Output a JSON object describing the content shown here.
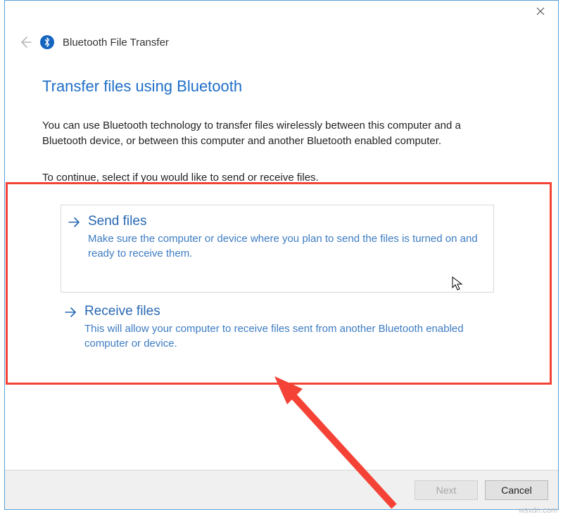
{
  "header": {
    "app_title": "Bluetooth File Transfer"
  },
  "page": {
    "title": "Transfer files using Bluetooth",
    "intro": "You can use Bluetooth technology to transfer files wirelessly between this computer and a Bluetooth device, or between this computer and another Bluetooth enabled computer.",
    "instruction": "To continue, select if you would like to send or receive files."
  },
  "options": {
    "send": {
      "title": "Send files",
      "desc": "Make sure the computer or device where you plan to send the files is turned on and ready to receive them."
    },
    "receive": {
      "title": "Receive files",
      "desc": "This will allow your computer to receive files sent from another Bluetooth enabled computer or device."
    }
  },
  "footer": {
    "next_label": "Next",
    "cancel_label": "Cancel"
  },
  "watermark": "wsxdn.com"
}
